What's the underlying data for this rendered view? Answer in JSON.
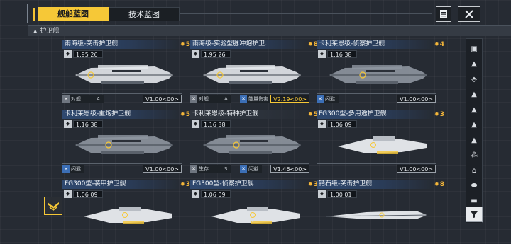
{
  "tabs": [
    {
      "label": "舰船蓝图",
      "active": true
    },
    {
      "label": "技术蓝图",
      "active": false
    }
  ],
  "section": {
    "label": "护卫舰"
  },
  "cards": [
    {
      "name": "雨海级-突击护卫舰",
      "rank": "5",
      "stat": "1.95 26",
      "ver": "V1.00<00>",
      "tags": [
        {
          "label": "对舰",
          "extra": "A"
        }
      ],
      "ship_color": "#e5e8ec"
    },
    {
      "name": "雨海级-实验型脉冲炮护卫...",
      "rank": "8",
      "stat": "1.95 26",
      "ver": "V2.19<00>",
      "ver_gold": true,
      "tags": [
        {
          "label": "对舰",
          "extra": "A"
        },
        {
          "label": "能量伤害"
        }
      ],
      "ship_color": "#e5e8ec"
    },
    {
      "name": "卡利莱恩级-侦察护卫舰",
      "rank": "4",
      "stat": "1.16 38",
      "ver": "V1.00<00>",
      "tags": [
        {
          "label": "闪避"
        }
      ],
      "ship_color": "#8f96a0"
    },
    {
      "name": "卡利莱恩级-重炮护卫舰",
      "rank": "5",
      "stat": "1.16 38",
      "ver": "V1.00<00>",
      "tags": [
        {
          "label": "闪避"
        }
      ],
      "ship_color": "#8f96a0"
    },
    {
      "name": "卡利莱恩级-特种护卫舰",
      "rank": "5",
      "stat": "1.16 38",
      "ver": "V1.46<00>",
      "tags": [
        {
          "label": "生存",
          "extra": "S"
        },
        {
          "label": "闪避"
        }
      ],
      "ship_color": "#8f96a0"
    },
    {
      "name": "FG300型-多用途护卫舰",
      "rank": "3",
      "stat": "1.06 09",
      "ver": "V1.00<00>",
      "tags": [],
      "ship_color": "#dfe2e6"
    },
    {
      "name": "FG300型-装甲护卫舰",
      "rank": "3",
      "stat": "1.06 09",
      "ver": "",
      "tags": [],
      "ship_color": "#dfe2e6"
    },
    {
      "name": "FG300型-侦察护卫舰",
      "rank": "3",
      "stat": "1.06 09",
      "ver": "",
      "tags": [],
      "ship_color": "#dfe2e6"
    },
    {
      "name": "锆石级-突击护卫舰",
      "rank": "8",
      "stat": "1.00 01",
      "ver": "",
      "tags": [],
      "ship_color": "#dfe2e6"
    }
  ],
  "sidebar_icons": [
    "ship-class-1",
    "ship-class-2",
    "ship-class-3",
    "ship-class-4",
    "ship-class-5",
    "ship-class-6",
    "ship-class-7",
    "ship-class-8",
    "ship-class-9",
    "ship-class-10",
    "ship-class-11"
  ],
  "accent_color": "#f6c837"
}
